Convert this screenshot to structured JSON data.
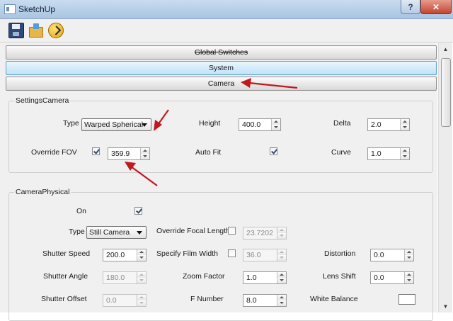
{
  "window": {
    "title": "SketchUp",
    "help_label": "?",
    "close_label": "✕"
  },
  "toolbar": {
    "icons": [
      "save-icon",
      "open-folder-icon",
      "extension-icon"
    ]
  },
  "sections": {
    "global": "Global Switches",
    "system": "System",
    "camera": "Camera"
  },
  "settings_camera": {
    "title": "SettingsCamera",
    "type_label": "Type",
    "type_value": "Warped Spherical",
    "height_label": "Height",
    "height_value": "400.0",
    "delta_label": "Delta",
    "delta_value": "2.0",
    "override_fov_label": "Override FOV",
    "override_fov_checked": true,
    "fov_value": "359.9",
    "auto_fit_label": "Auto Fit",
    "auto_fit_checked": true,
    "curve_label": "Curve",
    "curve_value": "1.0"
  },
  "camera_physical": {
    "title": "CameraPhysical",
    "on_label": "On",
    "on_checked": true,
    "type_label": "Type",
    "type_value": "Still Camera",
    "override_focal_label": "Override Focal Length",
    "override_focal_checked": false,
    "focal_value": "23.7202",
    "shutter_speed_label": "Shutter Speed",
    "shutter_speed_value": "200.0",
    "specify_film_label": "Specify Film Width",
    "specify_film_checked": false,
    "film_value": "36.0",
    "distortion_label": "Distortion",
    "distortion_value": "0.0",
    "shutter_angle_label": "Shutter Angle",
    "shutter_angle_value": "180.0",
    "zoom_label": "Zoom Factor",
    "zoom_value": "1.0",
    "lens_shift_label": "Lens Shift",
    "lens_shift_value": "0.0",
    "shutter_offset_label": "Shutter Offset",
    "shutter_offset_value": "0.0",
    "f_number_label": "F Number",
    "f_number_value": "8.0",
    "white_balance_label": "White Balance",
    "white_balance_color": "#ffffff"
  },
  "colors": {
    "annotation_arrow": "#c0181e",
    "accent_blue": "#5fa1d0"
  }
}
